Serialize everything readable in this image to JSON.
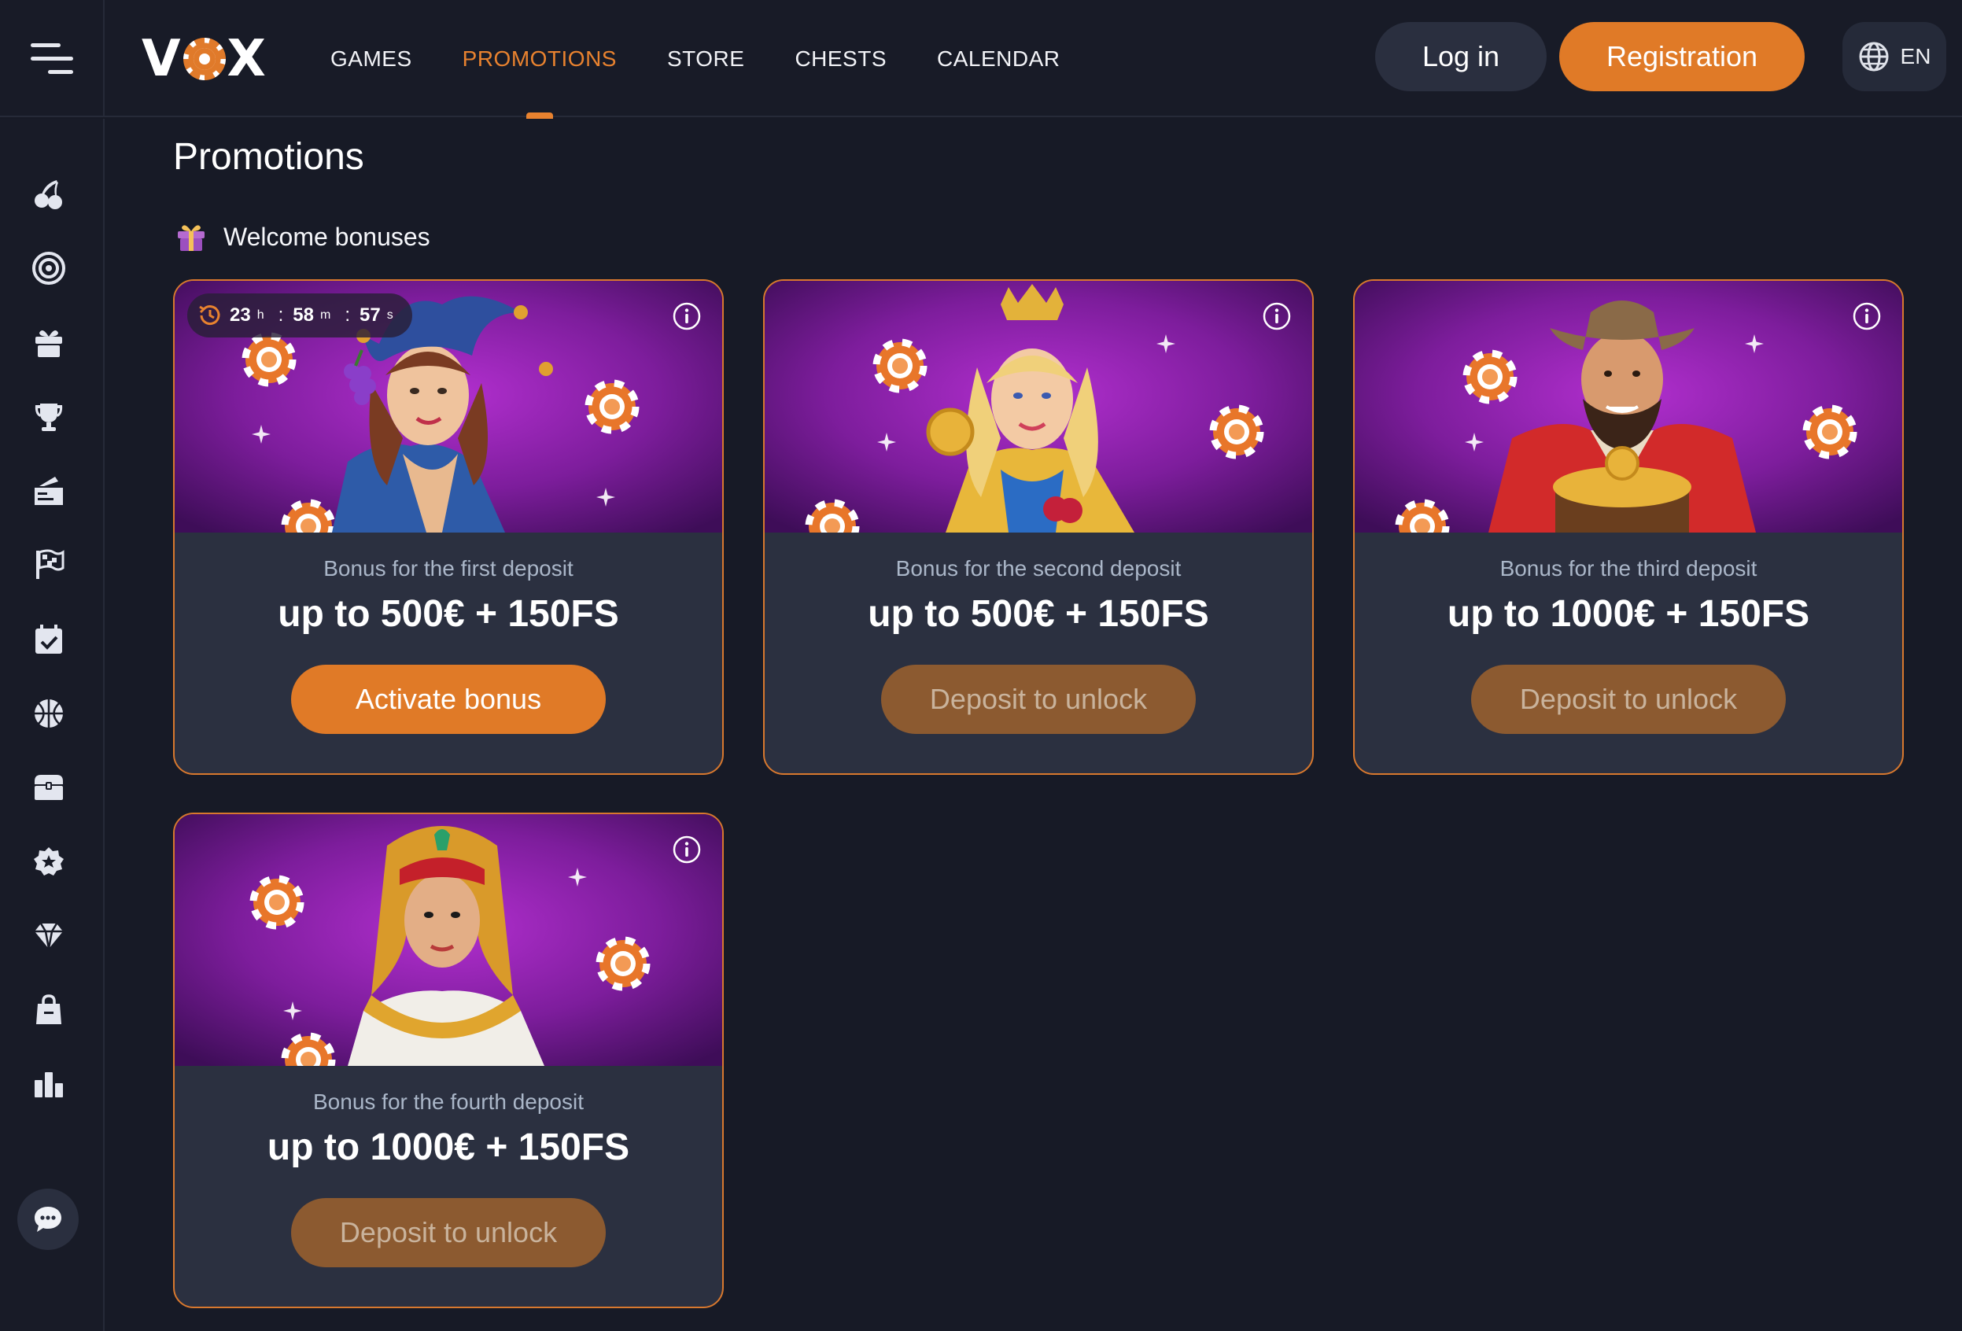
{
  "brand": {
    "logo_text_left": "V",
    "logo_text_right": "X"
  },
  "nav": [
    {
      "label": "GAMES",
      "active": false
    },
    {
      "label": "PROMOTIONS",
      "active": true
    },
    {
      "label": "STORE",
      "active": false
    },
    {
      "label": "CHESTS",
      "active": false
    },
    {
      "label": "CALENDAR",
      "active": false
    }
  ],
  "header": {
    "login_label": "Log in",
    "register_label": "Registration",
    "language": "EN"
  },
  "sidebar": {
    "icons": [
      "cherries-icon",
      "roulette-icon",
      "gift-icon",
      "trophy-icon",
      "ticket-icon",
      "race-flag-icon",
      "calendar-check-icon",
      "sports-ball-icon",
      "treasure-chest-icon",
      "badge-star-icon",
      "diamond-icon",
      "shopping-bag-icon",
      "leaderboard-icon"
    ],
    "chat_icon": "chat-icon"
  },
  "page": {
    "title": "Promotions",
    "section_label": "Welcome bonuses",
    "section_icon": "gift-icon"
  },
  "timer": {
    "hours": "23",
    "h": "h",
    "minutes": "58",
    "m": "m",
    "seconds": "57",
    "s": "s"
  },
  "bonuses": [
    {
      "subtitle": "Bonus for the first deposit",
      "amount": "up to 500€ + 150FS",
      "cta": "Activate bonus",
      "state": "active"
    },
    {
      "subtitle": "Bonus for the second deposit",
      "amount": "up to 500€ + 150FS",
      "cta": "Deposit to unlock",
      "state": "locked"
    },
    {
      "subtitle": "Bonus for the third deposit",
      "amount": "up to 1000€ + 150FS",
      "cta": "Deposit to unlock",
      "state": "locked"
    },
    {
      "subtitle": "Bonus for the fourth deposit",
      "amount": "up to 1000€ + 150FS",
      "cta": "Deposit to unlock",
      "state": "locked"
    }
  ],
  "colors": {
    "accent": "#e07a27",
    "background": "#171a26",
    "card": "#2b3040",
    "card_border": "#d8782e",
    "art_purple": "#8a1fa6"
  }
}
